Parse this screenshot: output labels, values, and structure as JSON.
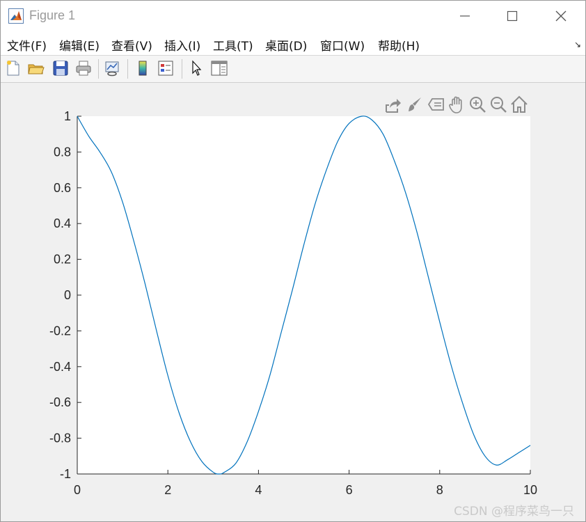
{
  "window": {
    "title": "Figure 1",
    "controls": [
      "minimize-icon",
      "maximize-icon",
      "close-icon"
    ]
  },
  "menu": {
    "items": [
      "文件(F)",
      "编辑(E)",
      "查看(V)",
      "插入(I)",
      "工具(T)",
      "桌面(D)",
      "窗口(W)",
      "帮助(H)"
    ]
  },
  "toolbar": {
    "icons": [
      "new-figure-icon",
      "open-file-icon",
      "save-icon",
      "print-icon",
      "link-plot-icon",
      "colorbar-icon",
      "legend-icon",
      "pointer-icon",
      "property-inspector-icon"
    ]
  },
  "axes_toolbar": {
    "icons": [
      "export-icon",
      "brush-icon",
      "datatip-icon",
      "pan-icon",
      "zoom-in-icon",
      "zoom-out-icon",
      "home-icon"
    ]
  },
  "watermark": "CSDN @程序菜鸟一只",
  "chart_data": {
    "type": "line",
    "title": "",
    "xlabel": "",
    "ylabel": "",
    "xlim": [
      0,
      10
    ],
    "ylim": [
      -1,
      1
    ],
    "xticks": [
      0,
      2,
      4,
      6,
      8,
      10
    ],
    "yticks": [
      1,
      0.8,
      0.6,
      0.4,
      0.2,
      0,
      -0.2,
      -0.4,
      -0.6,
      -0.8,
      -1
    ],
    "xtick_labels": [
      "0",
      "2",
      "4",
      "6",
      "8",
      "10"
    ],
    "ytick_labels": [
      "1",
      "0.8",
      "0.6",
      "0.4",
      "0.2",
      "0",
      "-0.2",
      "-0.4",
      "-0.6",
      "-0.8",
      "-1"
    ],
    "grid": false,
    "series": [
      {
        "color": "#0072bd",
        "x": [
          0,
          0.25,
          0.5,
          0.75,
          1.0,
          1.25,
          1.5,
          1.75,
          2.0,
          2.25,
          2.5,
          2.75,
          3.0,
          3.14,
          3.25,
          3.5,
          3.75,
          4.0,
          4.25,
          4.5,
          4.75,
          5.0,
          5.25,
          5.5,
          5.75,
          6.0,
          6.28,
          6.5,
          6.75,
          7.0,
          7.25,
          7.5,
          7.75,
          8.0,
          8.25,
          8.5,
          8.75,
          9.0,
          9.25,
          9.5,
          9.75,
          10.0
        ],
        "y": [
          1.0,
          0.89,
          0.8,
          0.69,
          0.52,
          0.3,
          0.06,
          -0.2,
          -0.45,
          -0.66,
          -0.82,
          -0.93,
          -0.99,
          -1.0,
          -0.99,
          -0.94,
          -0.82,
          -0.65,
          -0.45,
          -0.21,
          0.03,
          0.28,
          0.51,
          0.7,
          0.86,
          0.96,
          1.0,
          0.98,
          0.9,
          0.75,
          0.57,
          0.35,
          0.1,
          -0.15,
          -0.39,
          -0.6,
          -0.78,
          -0.9,
          -0.95,
          -0.92,
          -0.88,
          -0.84
        ]
      }
    ]
  }
}
